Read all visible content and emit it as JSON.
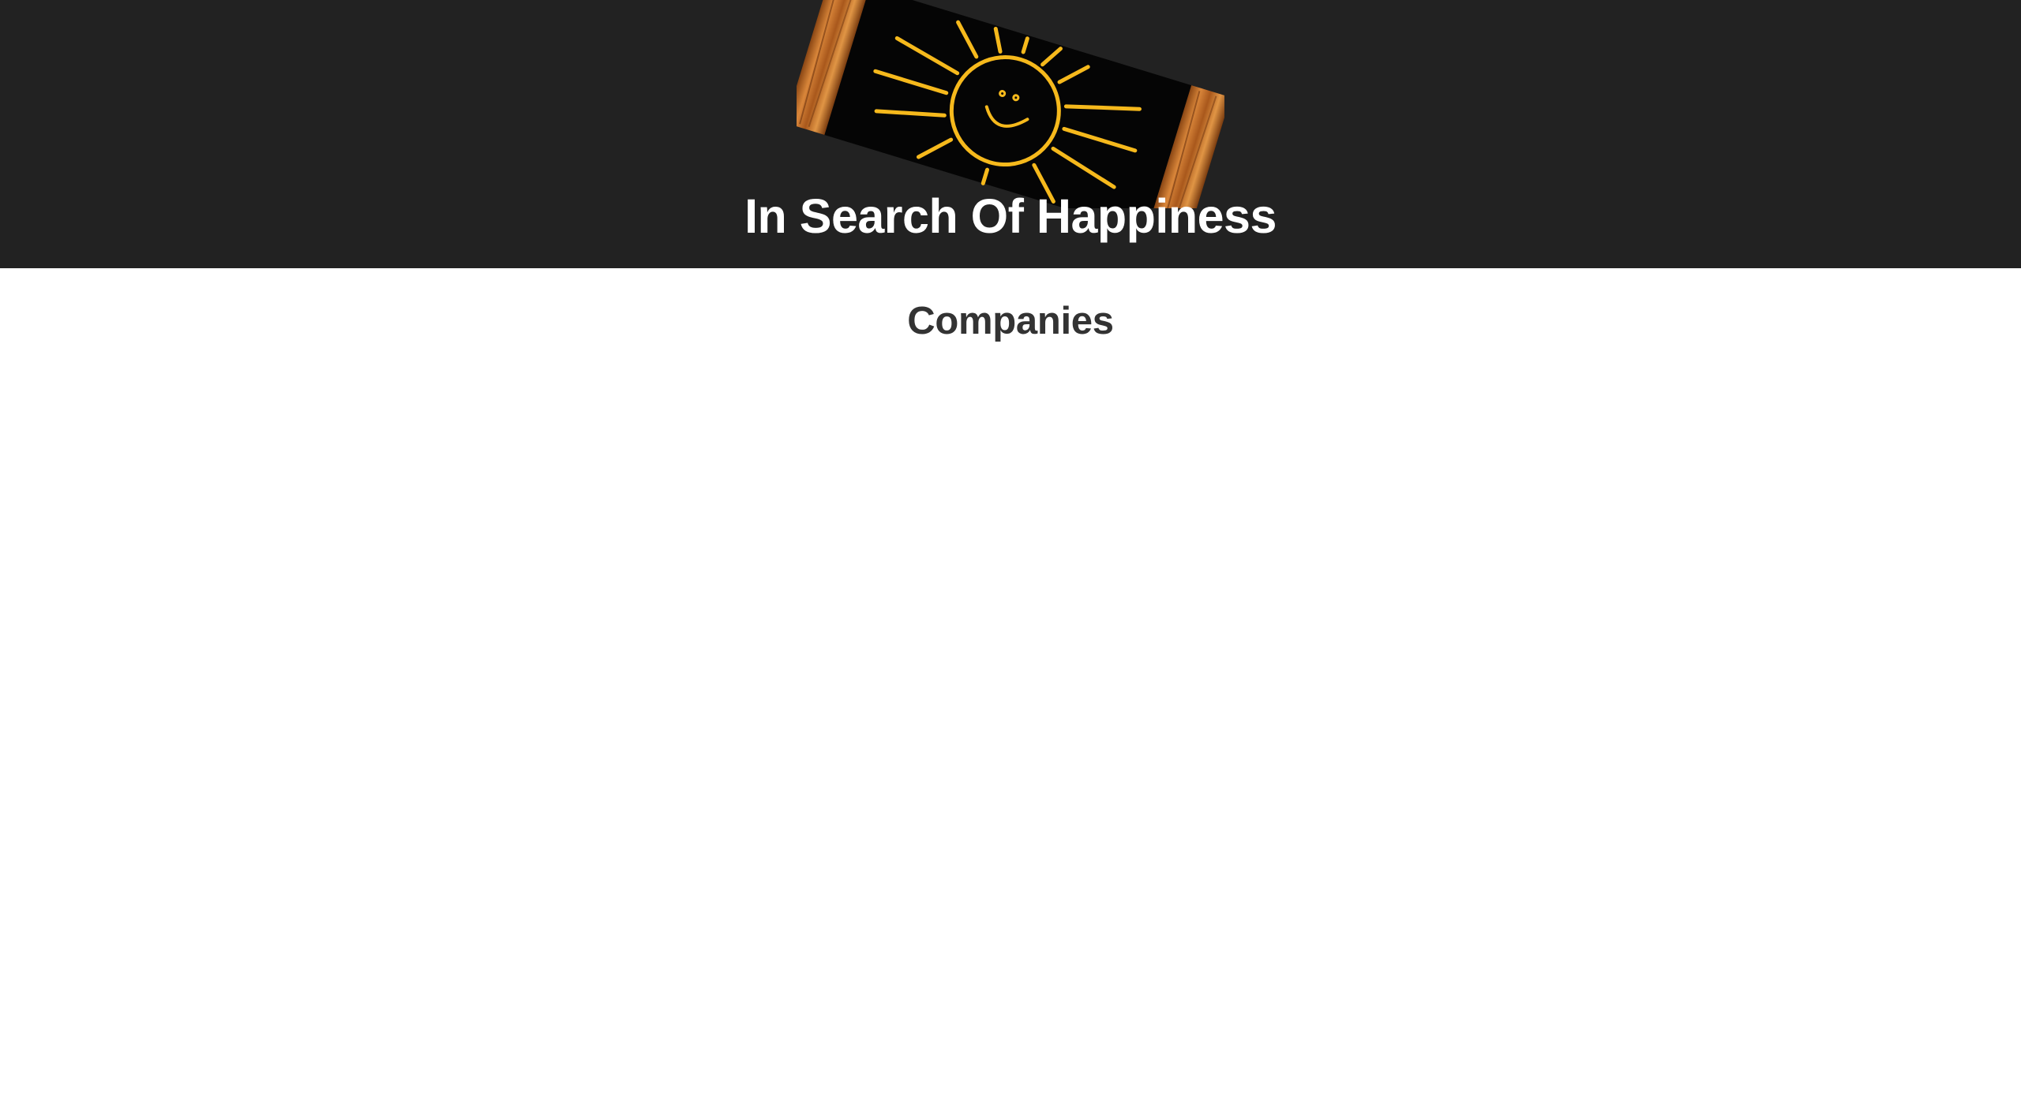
{
  "header": {
    "background_color": "#222222",
    "logo_icon": "smiling-sun-chalkboard-icon",
    "title": "In Search Of Happiness"
  },
  "main": {
    "section_title": "Companies"
  }
}
